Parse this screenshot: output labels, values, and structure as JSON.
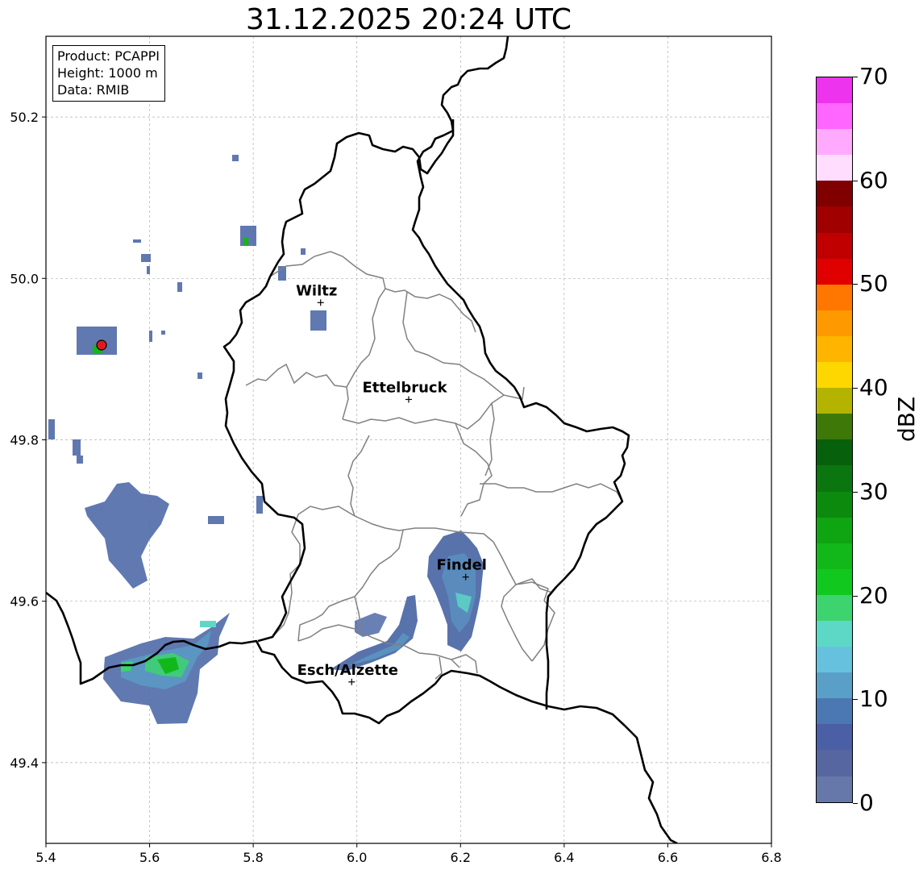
{
  "title": "31.12.2025 20:24 UTC",
  "info": {
    "product": "Product: PCAPPI",
    "height": "Height: 1000 m",
    "data": "Data: RMIB"
  },
  "axes": {
    "x_ticks": [
      "5.4",
      "5.6",
      "5.8",
      "6.0",
      "6.2",
      "6.4",
      "6.6",
      "6.8"
    ],
    "y_ticks": [
      "49.4",
      "49.6",
      "49.8",
      "50.0",
      "50.2"
    ],
    "xlim": [
      5.4,
      6.8
    ],
    "ylim": [
      49.3,
      50.3
    ],
    "grid": true
  },
  "cities": [
    {
      "name": "Wiltz",
      "lon": 5.93,
      "lat": 49.97
    },
    {
      "name": "Ettelbruck",
      "lon": 6.1,
      "lat": 49.85
    },
    {
      "name": "Findel",
      "lon": 6.21,
      "lat": 49.63
    },
    {
      "name": "Esch/Alzette",
      "lon": 5.99,
      "lat": 49.5
    }
  ],
  "radar_site": {
    "lon": 5.505,
    "lat": 49.915,
    "color": "#e31a1c"
  },
  "colorbar": {
    "label": "dBZ",
    "min": 0,
    "max": 70,
    "tick_labels": [
      "0",
      "10",
      "20",
      "30",
      "40",
      "50",
      "60",
      "70"
    ],
    "colors": [
      "#6677aa",
      "#5566a0",
      "#4a5fa5",
      "#4b78b3",
      "#5a9fc8",
      "#66c1de",
      "#5ed8c6",
      "#3dd46f",
      "#11c91e",
      "#12b81a",
      "#0fa412",
      "#0b8a0e",
      "#0b7510",
      "#07600b",
      "#3d7808",
      "#b3b300",
      "#ffd700",
      "#ffb400",
      "#ff9900",
      "#ff7700",
      "#e00000",
      "#c00000",
      "#a00000",
      "#800000",
      "#ffddff",
      "#ffaaff",
      "#ff66ff",
      "#ee33ee"
    ]
  },
  "precipitation_cells": [
    {
      "lon": 5.6,
      "lat": 49.52,
      "dbz": 10
    },
    {
      "lon": 5.64,
      "lat": 49.52,
      "dbz": 22
    },
    {
      "lon": 5.69,
      "lat": 49.56,
      "dbz": 12
    },
    {
      "lon": 6.2,
      "lat": 49.64,
      "dbz": 10
    },
    {
      "lon": 6.21,
      "lat": 49.61,
      "dbz": 16
    },
    {
      "lon": 6.06,
      "lat": 49.55,
      "dbz": 12
    },
    {
      "lon": 5.53,
      "lat": 49.7,
      "dbz": 6
    }
  ]
}
